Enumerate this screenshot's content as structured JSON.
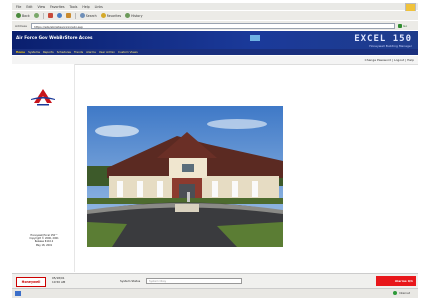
{
  "browser": {
    "menu": [
      "File",
      "Edit",
      "View",
      "Favorites",
      "Tools",
      "Help",
      "Links"
    ],
    "toolbar": {
      "back": "Back",
      "forward": "",
      "stop": "",
      "refresh": "",
      "home": "",
      "search": "Search",
      "favorites": "Favorites",
      "history": "History"
    },
    "address": {
      "label": "Address",
      "url": "https://ebi/ebi/sites/xxxx/ebi.asp",
      "go_label": "Go"
    }
  },
  "app": {
    "title": "Air Force Gov  WebBrStore Acces",
    "logo_big": "EXCEL 150",
    "logo_small": "Honeywell Building Manager",
    "nav": [
      "Home",
      "Systems",
      "Reports",
      "Schedules",
      "Trends",
      "Alarms",
      "User Admin",
      "Custom Views"
    ],
    "change_password": "Change Password | Logout | Help"
  },
  "left_panel": {
    "info_lines": [
      "Honeywell Excel 150™",
      "Copyright © 2000, 2001",
      "Release R110.2",
      "May 18, 2001"
    ]
  },
  "bottom": {
    "brand": "Honeywell",
    "date": "05/18/01",
    "time": "10:50 AM",
    "system_status_label": "System Status",
    "system_status_value": "System Okay",
    "alarm_label": "Alarms 0/1"
  },
  "status_bar": {
    "zone": "Internet"
  },
  "colors": {
    "header_blue": "#0a1f6e",
    "alarm_red": "#e8171b",
    "nav_yellow": "#ffeb7a"
  }
}
